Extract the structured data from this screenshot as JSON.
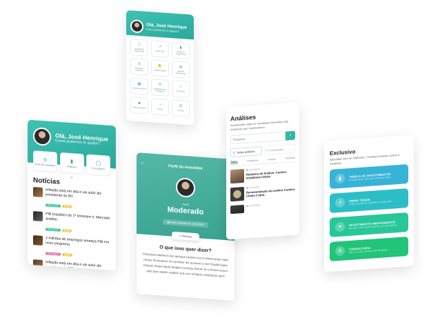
{
  "home_top": {
    "greeting": "Olá, José Henrique",
    "subtitle": "Como podemos te ajudar?",
    "tiles": [
      {
        "label": "Investimento independente",
        "icon": "info-icon"
      },
      {
        "label": "Swing Trade",
        "icon": "trend-icon"
      },
      {
        "label": "Carteira de investimentos",
        "icon": "bars-icon"
      },
      {
        "label": "Resultados financeiros",
        "icon": "dollar-icon"
      },
      {
        "label": "Análises diárias",
        "icon": "hand-coin-icon"
      },
      {
        "label": "Assuntos internacionais",
        "icon": "globe-icon"
      },
      {
        "label": "Eventos Ano Novo",
        "icon": "calendar-icon"
      },
      {
        "label": "Estratégias para investidores",
        "icon": "chat-icon"
      },
      {
        "label": "Consultoria",
        "icon": "people-icon"
      },
      {
        "label": "Perfil do investidor",
        "icon": "user-icon"
      },
      {
        "label": "Fundos",
        "icon": "pie-icon"
      },
      {
        "label": "Notícias",
        "icon": "news-icon"
      }
    ]
  },
  "home_news": {
    "greeting": "Olá, José Henrique",
    "subtitle": "Como podemos te ajudar?",
    "shortcuts": [
      {
        "label": "Perfil do investidor",
        "icon": "user-icon"
      },
      {
        "label": "Análises",
        "icon": "bars-icon"
      },
      {
        "label": "Consultoria",
        "icon": "chat-icon"
      }
    ],
    "section_title": "Notícias",
    "news": [
      {
        "title": "Inflação está em alta e vai subir diz presidente do BC.",
        "tags": [
          "Economia",
          "Brasil"
        ]
      },
      {
        "title": "PIB brasileiro do 1º trimestre tr. Mercado analisa.",
        "tags": [
          "Economia",
          "Brasil"
        ]
      },
      {
        "title": "2 milhões de empregos ameaça PIB em novo programa.",
        "tags": [
          "Empregos",
          "Brasil"
        ]
      },
      {
        "title": "Inflação está em alta e vai subir diz presidente do BC.",
        "tags": [
          "Economia",
          "Brasil"
        ]
      }
    ]
  },
  "profile": {
    "header": "Perfil do investidor",
    "label": "Perfil",
    "value": "Moderado",
    "date_note": "Teste realizado em 12/11/2020",
    "refazer": "Refazer",
    "question": "O que isso quer dizer?",
    "paragraph": "Parturient eleifend cras quisque pretium est et ullamcorper eget neque himenaeos orci porttitor dis posuere a nisl fringilla ligula tempus augue ligula feugiat sociosqu dictum et a dictum ipsum quis quis sapien sagittis sed cum tristique vestibulum taciti"
  },
  "analyses": {
    "title": "Análises",
    "subtitle": "Acompanhe todas as novidades relevantes das empresas que monitoramos.",
    "search_placeholder": "Pesquisar",
    "tabs": [
      "Todas análises",
      "Compradas"
    ],
    "filters": [
      "Todos",
      "Relatórios",
      "Artigos",
      "Carteiras"
    ],
    "items": [
      {
        "date": "12/11/2020",
        "title": "Relatório de Análise: Carteira Imobiliária Cíbola"
      },
      {
        "date": "12/11/2020",
        "title": "Recomendação da carteira Carteira Cíbola Cripto."
      },
      {
        "date": "12/11/2020",
        "title": ""
      }
    ]
  },
  "exclusive": {
    "title": "Exclusivo",
    "subtitle": "Aproveite com os melhores. Conheça nossos cursos e carteiras.",
    "cards": [
      {
        "title": "TABELA DE INVESTIMENTOS",
        "desc": "Descubra qual a ação mais rentável da bolsa.",
        "color": "#37b3d6",
        "icon": "bars-icon"
      },
      {
        "title": "SWING TRADE",
        "desc": "Confira as melhores sugestões de swing trade.",
        "color": "#2bbfc5",
        "icon": "trend-icon"
      },
      {
        "title": "INVESTIMENTO INDEPENDENTE",
        "desc": "Não sabe onde investir? Aprenda com especialistas.",
        "color": "#27c79a",
        "icon": "lamp-icon"
      },
      {
        "title": "CONSULTORIA",
        "desc": "Fale com nosso consultor pelo WhatsApp.",
        "color": "#22c47a",
        "icon": "whatsapp-icon"
      }
    ]
  }
}
